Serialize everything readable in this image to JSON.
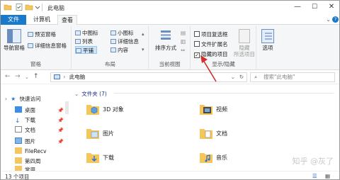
{
  "window": {
    "title": "此电脑"
  },
  "tabs": [
    "文件",
    "计算机",
    "查看"
  ],
  "ribbon": {
    "pane": {
      "nav_pane": "导航窗格",
      "preview_pane": "预览窗格",
      "details_pane": "详细信息窗格",
      "label": "窗格"
    },
    "layout": {
      "medium": "中图标",
      "list": "列表",
      "tiles": "平铺",
      "small": "小图标",
      "details": "详细信息",
      "content": "内容",
      "label": "布局"
    },
    "current_view": {
      "sort": "排序方式",
      "label": "当前视图"
    },
    "show_hide": {
      "item_checkboxes": "项目复选框",
      "file_ext": "文件扩展名",
      "hidden_items": "隐藏的项目",
      "hide": "隐藏",
      "hide_sub": "所选项目",
      "label": "显示/隐藏",
      "hidden_checked": true
    },
    "options": {
      "label": "选项"
    }
  },
  "address": {
    "path": "此电脑",
    "search_placeholder": "搜索\"此电脑\""
  },
  "sidebar": {
    "quick_access": "快速访问",
    "items": [
      "桌面",
      "下载",
      "文档",
      "图片",
      "FileRecv",
      "第四周",
      "常用"
    ]
  },
  "content": {
    "group_header": "文件夹 (7)",
    "folders": [
      "3D 对象",
      "视频",
      "图片",
      "文档",
      "下载",
      "音乐"
    ]
  },
  "status": {
    "count": "13 个项目"
  },
  "watermark": "知乎 @灰了",
  "colors": {
    "accent": "#1979ca",
    "arrow": "#d0302b"
  }
}
